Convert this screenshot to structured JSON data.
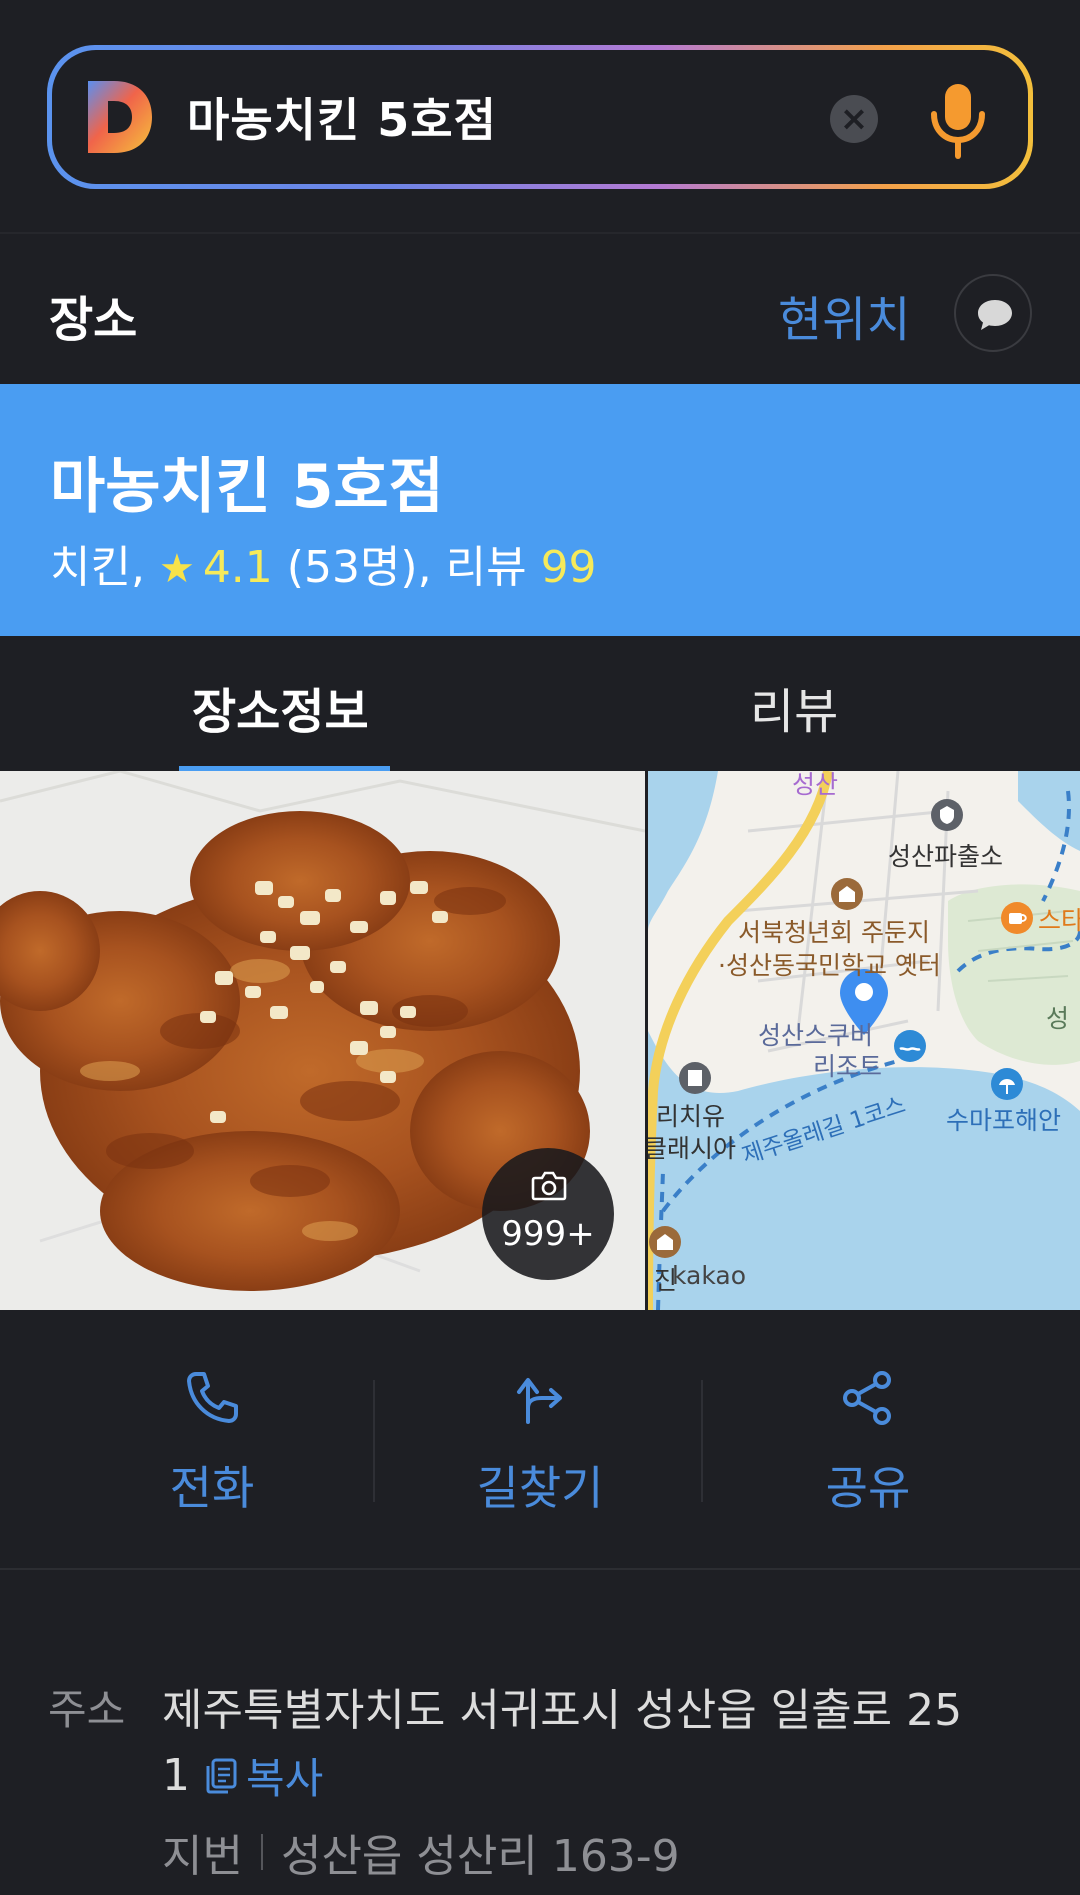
{
  "search": {
    "query": "마농치킨 5호점",
    "clear_symbol": "×"
  },
  "section": {
    "title": "장소",
    "current_location": "현위치"
  },
  "place": {
    "name": "마농치킨 5호점",
    "category": "치킨,",
    "rating": "4.1",
    "rating_count": "(53명),",
    "review_label": "리뷰",
    "review_count": "99"
  },
  "tabs": [
    {
      "label": "장소정보",
      "active": true
    },
    {
      "label": "리뷰",
      "active": false
    }
  ],
  "photo": {
    "count": "999+"
  },
  "map": {
    "labels": [
      "성산",
      "성산파출소",
      "서북청년회 주둔지",
      "·성산동국민학교 옛터",
      "성산스쿠버",
      "리조트",
      "스타",
      "성",
      "리치유",
      "클래시아",
      "제주올레길 1코스",
      "수마포해안",
      "진",
      "kakao"
    ]
  },
  "actions": [
    {
      "label": "전화",
      "icon": "phone-icon"
    },
    {
      "label": "길찾기",
      "icon": "directions-icon"
    },
    {
      "label": "공유",
      "icon": "share-icon"
    }
  ],
  "address": {
    "label": "주소",
    "line1": "제주특별자치도 서귀포시 성산읍 일출로 25",
    "line2": "1",
    "copy_label": "복사",
    "jibun_label": "지번",
    "jibun_value": "성산읍 성산리 163-9"
  },
  "colors": {
    "background": "#1e1f24",
    "banner": "#4a9df2",
    "accent_blue": "#4a8bdb",
    "rating_yellow": "#f6ea5a"
  }
}
